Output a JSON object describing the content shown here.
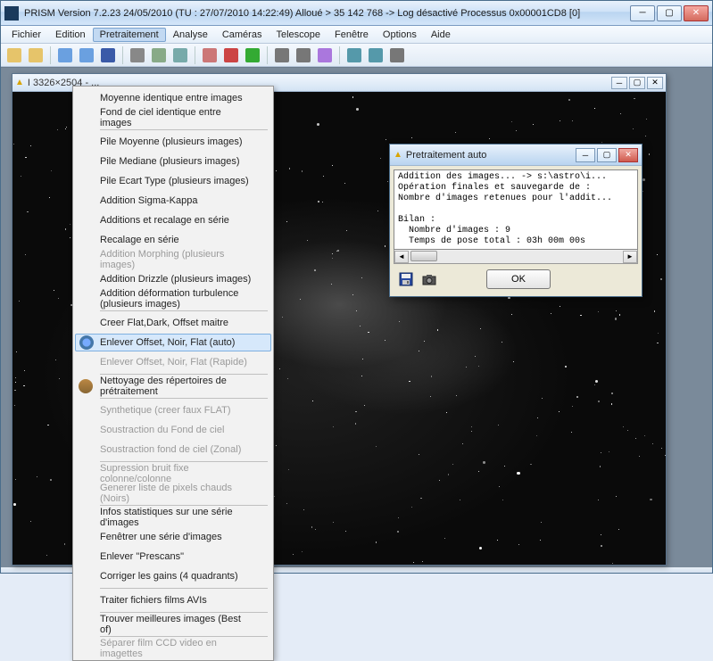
{
  "window": {
    "title": "PRISM    Version 7.2.23   24/05/2010   (TU : 27/07/2010 14:22:49) Alloué > 35 142 768 -> Log désactivé   Processus 0x00001CD8 [0]"
  },
  "menubar": {
    "items": [
      "Fichier",
      "Edition",
      "Pretraitement",
      "Analyse",
      "Caméras",
      "Telescope",
      "Fenêtre",
      "Options",
      "Aide"
    ],
    "active_index": 2
  },
  "toolbar": {
    "icons": [
      "folder-open-icon",
      "folder-icon",
      "cascade-icon",
      "tile-icon",
      "save-icon",
      "print-icon",
      "copy-icon",
      "manage-icon",
      "palette-icon",
      "colors-icon",
      "histogram-icon",
      "levels-a-icon",
      "levels-b-icon",
      "wand-icon",
      "zoom-out-icon",
      "zoom-in-icon",
      "crop-icon"
    ]
  },
  "image_window": {
    "title": "I 3326×2504 - ..."
  },
  "dropdown": {
    "items": [
      {
        "label": "Moyenne identique entre images",
        "enabled": true
      },
      {
        "label": "Fond de ciel identique entre images",
        "enabled": true
      },
      {
        "sep": true
      },
      {
        "label": "Pile Moyenne  (plusieurs images)",
        "enabled": true
      },
      {
        "label": "Pile Mediane  (plusieurs images)",
        "enabled": true
      },
      {
        "label": "Pile Ecart Type  (plusieurs images)",
        "enabled": true
      },
      {
        "label": "Addition Sigma-Kappa",
        "enabled": true
      },
      {
        "label": "Additions et recalage en série",
        "enabled": true
      },
      {
        "label": "Recalage en série",
        "enabled": true
      },
      {
        "label": "Addition Morphing (plusieurs images)",
        "enabled": false
      },
      {
        "label": "Addition Drizzle (plusieurs images)",
        "enabled": true
      },
      {
        "label": "Addition déformation turbulence (plusieurs images)",
        "enabled": true
      },
      {
        "sep": true
      },
      {
        "label": "Creer Flat,Dark, Offset maitre",
        "enabled": true
      },
      {
        "label": "Enlever Offset, Noir, Flat (auto)",
        "enabled": true,
        "highlight": true,
        "icon": "gear-icon"
      },
      {
        "label": "Enlever Offset, Noir, Flat (Rapide)",
        "enabled": false
      },
      {
        "sep": true
      },
      {
        "label": "Nettoyage des répertoires de prétraitement",
        "enabled": true,
        "icon": "broom-icon"
      },
      {
        "sep": true
      },
      {
        "label": "Synthetique (creer faux FLAT)",
        "enabled": false
      },
      {
        "label": "Soustraction du Fond de ciel",
        "enabled": false
      },
      {
        "label": "Soustraction fond de ciel (Zonal)",
        "enabled": false
      },
      {
        "sep": true
      },
      {
        "label": "Supression bruit fixe colonne/colonne",
        "enabled": false
      },
      {
        "label": "Generer liste de pixels chauds (Noirs)",
        "enabled": false
      },
      {
        "sep": true
      },
      {
        "label": "Infos statistiques sur une série d'images",
        "enabled": true
      },
      {
        "label": "Fenêtrer une série d'images",
        "enabled": true
      },
      {
        "label": "Enlever \"Prescans\"",
        "enabled": true
      },
      {
        "label": "Corriger les gains (4 quadrants)",
        "enabled": true
      },
      {
        "sep": true
      },
      {
        "label": "Traiter fichiers films AVIs",
        "enabled": true
      },
      {
        "sep": true
      },
      {
        "label": "Trouver meilleures images (Best of)",
        "enabled": true
      },
      {
        "sep": true
      },
      {
        "label": "Séparer film CCD video en imagettes",
        "enabled": false
      }
    ]
  },
  "dialog": {
    "title": "Pretraitement auto",
    "log_lines": [
      "Addition des images... -> s:\\astro\\i...",
      "Opération finales et sauvegarde de :",
      "Nombre d'images retenues pour l'addit...",
      "",
      "Bilan :",
      "  Nombre d'images : 9",
      "  Temps de pose total : 03h 00m 00s"
    ],
    "ok_label": "OK"
  }
}
